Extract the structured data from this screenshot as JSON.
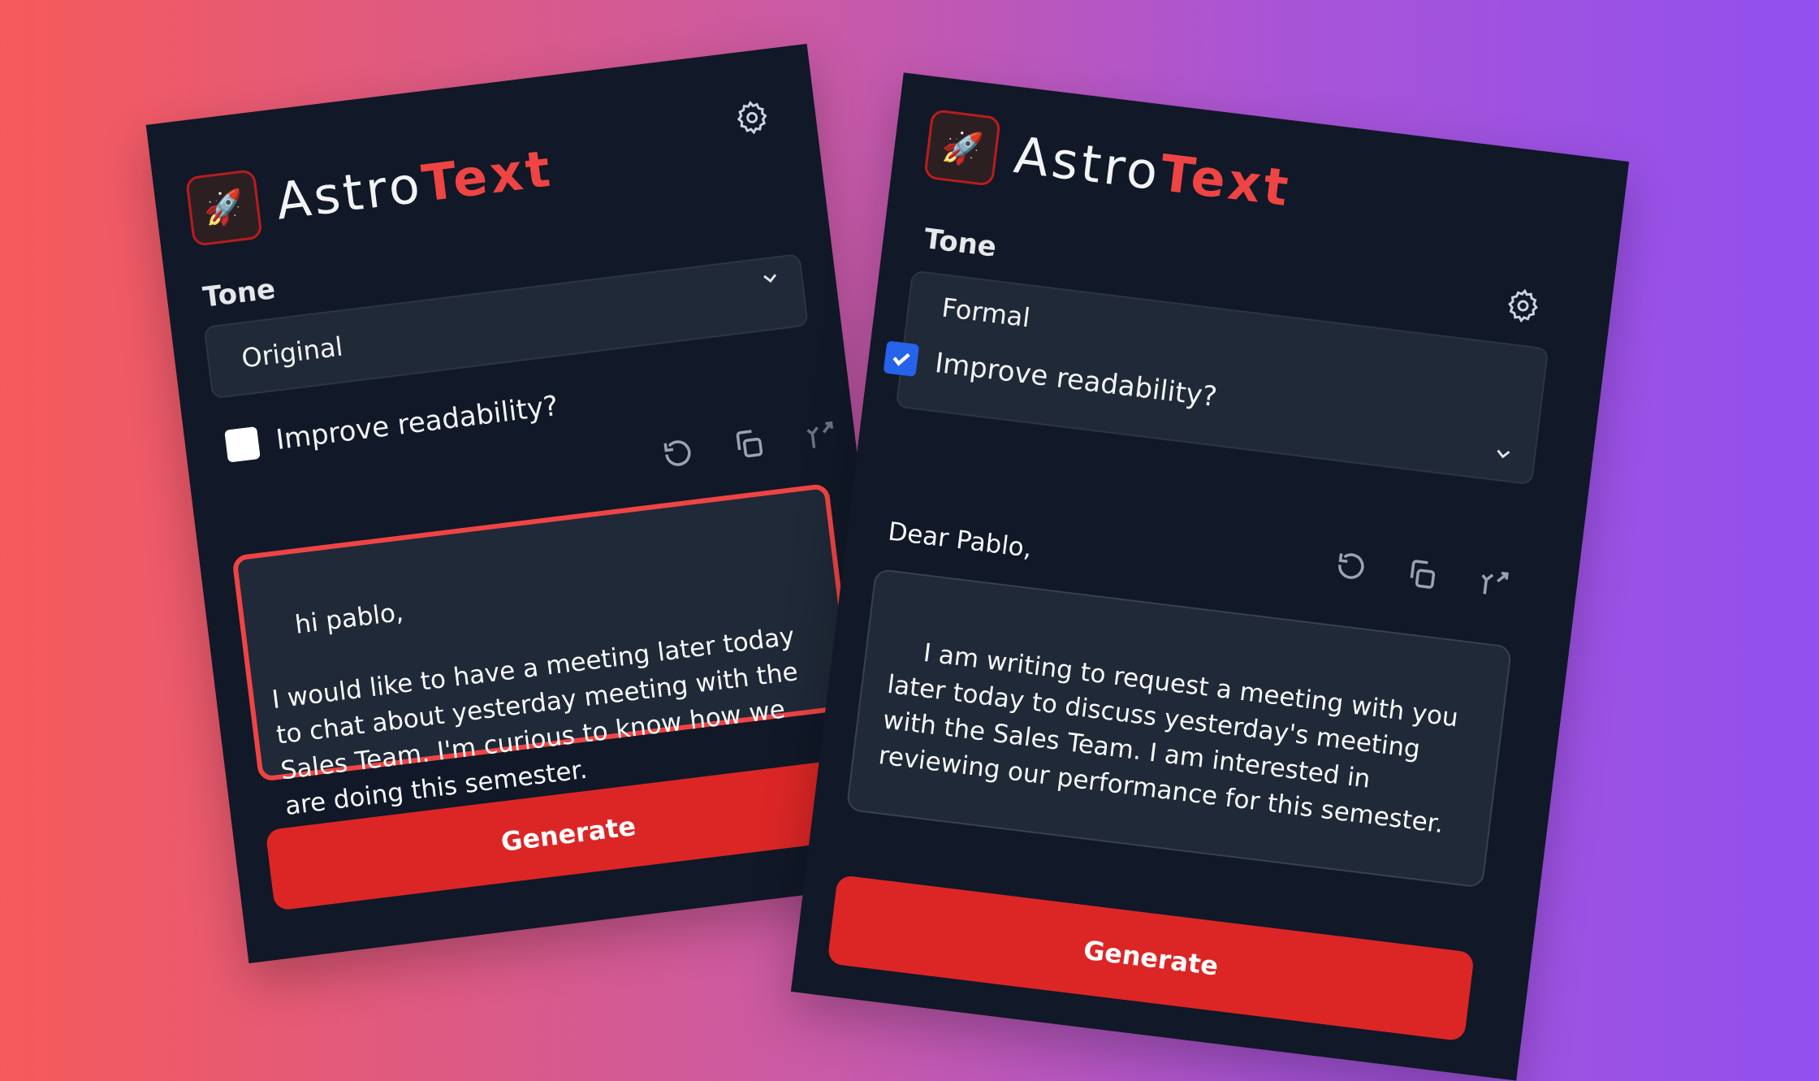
{
  "app": {
    "name_main": "Astro",
    "name_accent": "Text"
  },
  "colors": {
    "accent": "#ef4444",
    "panel_bg": "#111827",
    "field_bg": "#1f2937",
    "checkbox_on": "#2563eb"
  },
  "icons": [
    "rocket-icon",
    "gear-icon",
    "chevron-down-icon",
    "undo-icon",
    "copy-icon",
    "merge-icon",
    "checkmark-icon"
  ],
  "left_panel": {
    "tone_label": "Tone",
    "tone_value": "Original",
    "readability_label": "Improve readability?",
    "readability_checked": false,
    "text": "hi pablo,\n\nI would like to have a meeting later today to chat about yesterday meeting with the Sales Team. I'm curious to know how we are doing this semester.",
    "generate_label": "Generate"
  },
  "right_panel": {
    "tone_label": "Tone",
    "tone_value": "Formal",
    "readability_label": "Improve readability?",
    "readability_checked": true,
    "greeting": "Dear Pablo,",
    "text": "I am writing to request a meeting with you later today to discuss yesterday's meeting with the Sales Team. I am interested in reviewing our performance for this semester.",
    "generate_label": "Generate"
  }
}
